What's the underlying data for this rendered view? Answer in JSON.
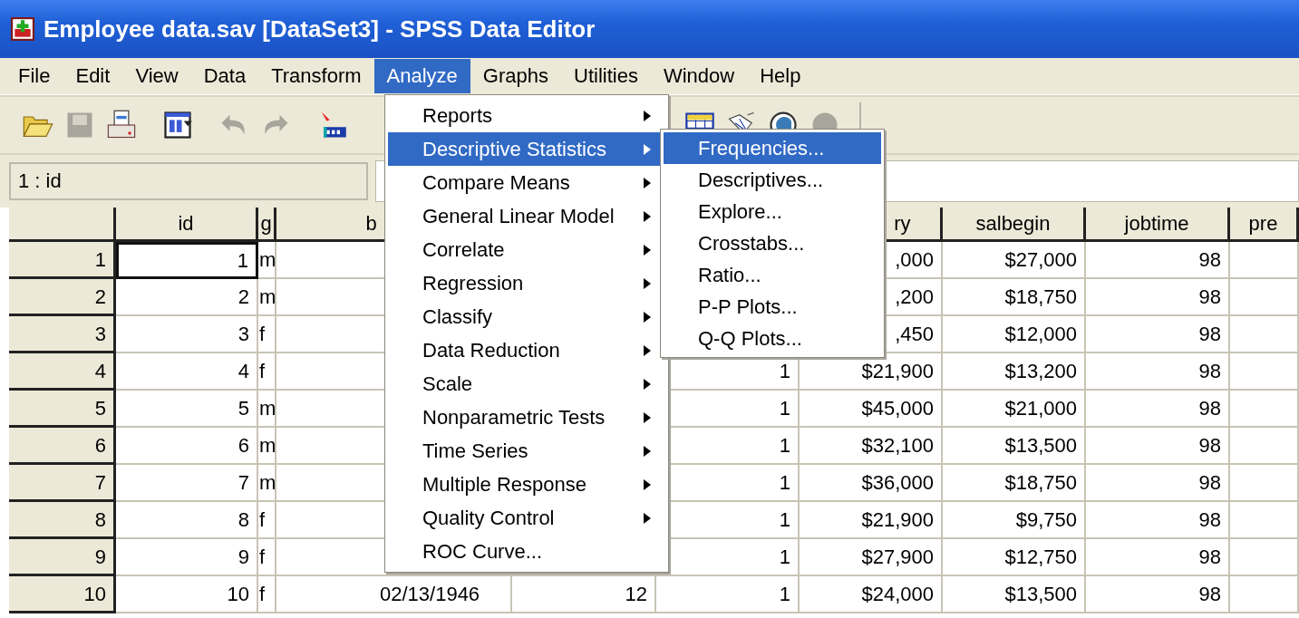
{
  "window": {
    "title": "Employee data.sav [DataSet3] - SPSS Data Editor"
  },
  "menu_bar": [
    {
      "label": "File",
      "selected": false
    },
    {
      "label": "Edit",
      "selected": false
    },
    {
      "label": "View",
      "selected": false
    },
    {
      "label": "Data",
      "selected": false
    },
    {
      "label": "Transform",
      "selected": false
    },
    {
      "label": "Analyze",
      "selected": true
    },
    {
      "label": "Graphs",
      "selected": false
    },
    {
      "label": "Utilities",
      "selected": false
    },
    {
      "label": "Window",
      "selected": false
    },
    {
      "label": "Help",
      "selected": false
    }
  ],
  "cell_reference": "1 : id",
  "table": {
    "columns": [
      "id",
      "g",
      "b",
      null,
      null,
      "ry",
      "salbegin",
      "jobtime",
      "pre"
    ],
    "rows": [
      {
        "header": "1",
        "current": true,
        "cells": [
          "1",
          "m",
          null,
          null,
          null,
          ",000",
          "$27,000",
          "98",
          null
        ]
      },
      {
        "header": "2",
        "current": false,
        "cells": [
          "2",
          "m",
          null,
          null,
          null,
          ",200",
          "$18,750",
          "98",
          null
        ]
      },
      {
        "header": "3",
        "current": false,
        "cells": [
          "3",
          "f",
          null,
          null,
          null,
          ",450",
          "$12,000",
          "98",
          null
        ]
      },
      {
        "header": "4",
        "current": false,
        "cells": [
          "4",
          "f",
          null,
          null,
          "1",
          "$21,900",
          "$13,200",
          "98",
          null
        ]
      },
      {
        "header": "5",
        "current": false,
        "cells": [
          "5",
          "m",
          null,
          null,
          "1",
          "$45,000",
          "$21,000",
          "98",
          null
        ]
      },
      {
        "header": "6",
        "current": false,
        "cells": [
          "6",
          "m",
          null,
          null,
          "1",
          "$32,100",
          "$13,500",
          "98",
          null
        ]
      },
      {
        "header": "7",
        "current": false,
        "cells": [
          "7",
          "m",
          null,
          null,
          "1",
          "$36,000",
          "$18,750",
          "98",
          null
        ]
      },
      {
        "header": "8",
        "current": false,
        "cells": [
          "8",
          "f",
          null,
          null,
          "1",
          "$21,900",
          "$9,750",
          "98",
          null
        ]
      },
      {
        "header": "9",
        "current": false,
        "cells": [
          "9",
          "f",
          null,
          null,
          "1",
          "$27,900",
          "$12,750",
          "98",
          null
        ]
      },
      {
        "header": "10",
        "current": false,
        "cells": [
          "10",
          "f",
          "02/13/1946",
          "12",
          "1",
          "$24,000",
          "$13,500",
          "98",
          null
        ]
      }
    ]
  },
  "analyze_menu": [
    {
      "label": "Reports",
      "submenu": true,
      "selected": false
    },
    {
      "label": "Descriptive Statistics",
      "submenu": true,
      "selected": true
    },
    {
      "label": "Compare Means",
      "submenu": true,
      "selected": false
    },
    {
      "label": "General Linear Model",
      "submenu": true,
      "selected": false
    },
    {
      "label": "Correlate",
      "submenu": true,
      "selected": false
    },
    {
      "label": "Regression",
      "submenu": true,
      "selected": false
    },
    {
      "label": "Classify",
      "submenu": true,
      "selected": false
    },
    {
      "label": "Data Reduction",
      "submenu": true,
      "selected": false
    },
    {
      "label": "Scale",
      "submenu": true,
      "selected": false
    },
    {
      "label": "Nonparametric Tests",
      "submenu": true,
      "selected": false
    },
    {
      "label": "Time Series",
      "submenu": true,
      "selected": false
    },
    {
      "label": "Multiple Response",
      "submenu": true,
      "selected": false
    },
    {
      "label": "Quality Control",
      "submenu": true,
      "selected": false
    },
    {
      "label": "ROC Curve...",
      "submenu": false,
      "selected": false
    }
  ],
  "descriptive_submenu": [
    {
      "label": "Frequencies...",
      "selected": true
    },
    {
      "label": "Descriptives...",
      "selected": false
    },
    {
      "label": "Explore...",
      "selected": false
    },
    {
      "label": "Crosstabs...",
      "selected": false
    },
    {
      "label": "Ratio...",
      "selected": false
    },
    {
      "label": "P-P Plots...",
      "selected": false
    },
    {
      "label": "Q-Q Plots...",
      "selected": false
    }
  ]
}
